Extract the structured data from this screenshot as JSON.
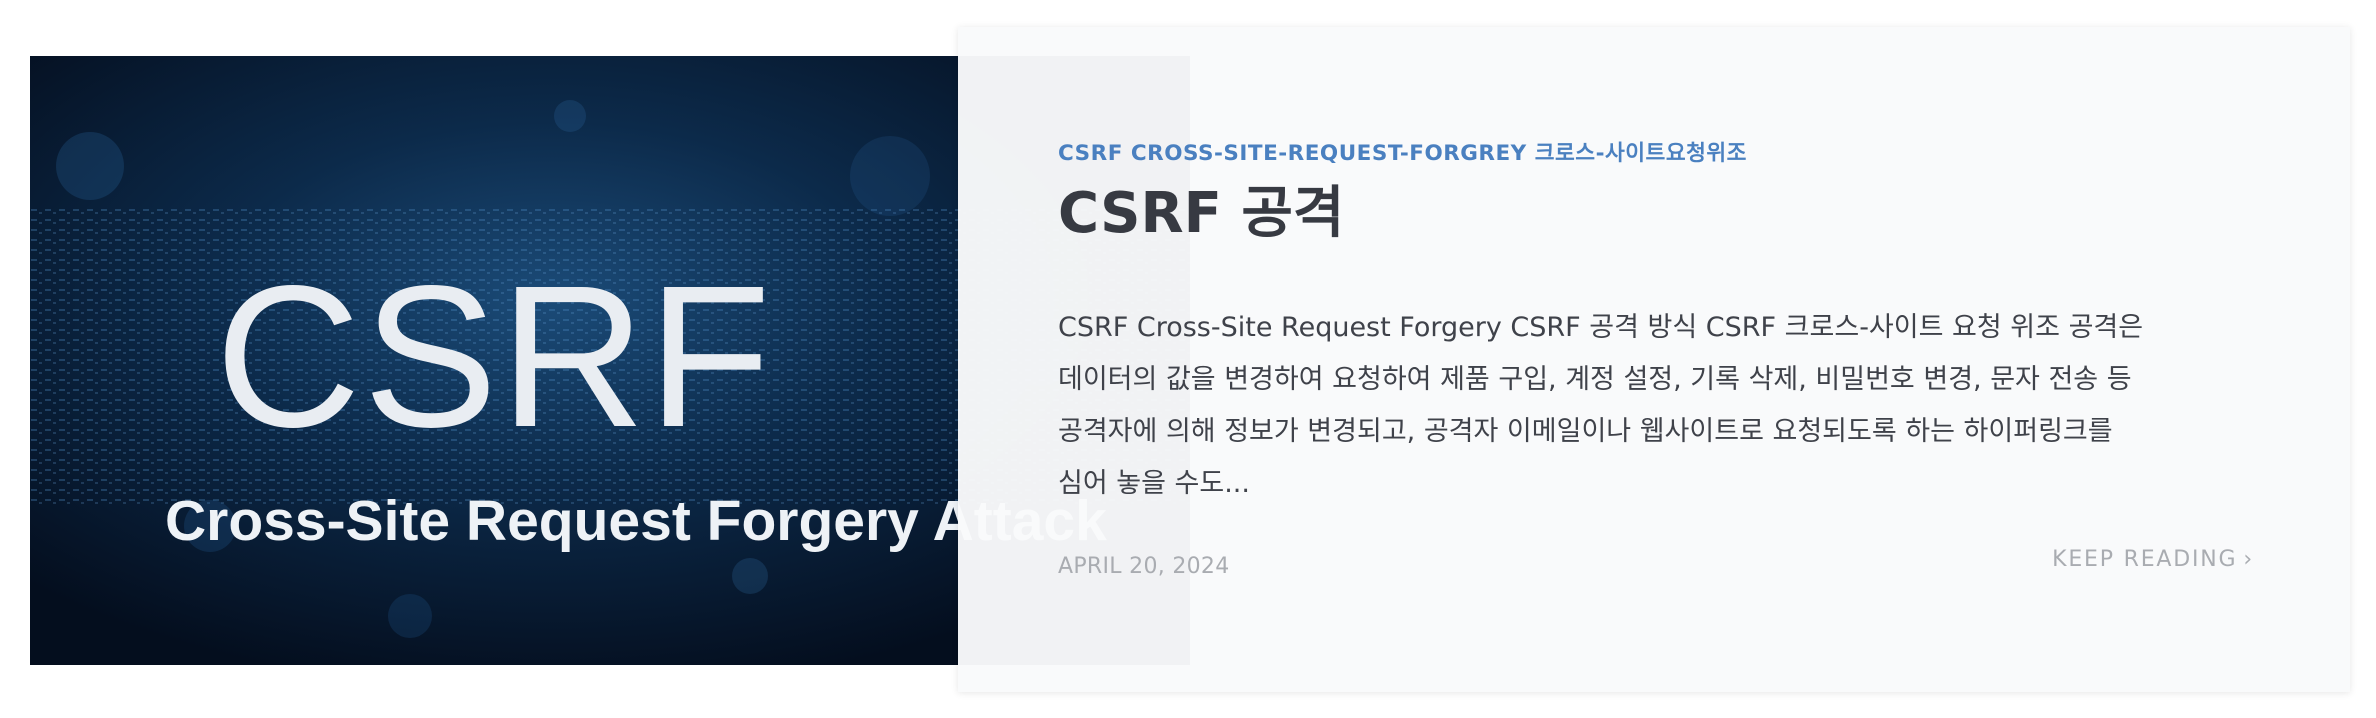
{
  "hero": {
    "title": "CSRF",
    "subtitle": "Cross-Site Request Forgery Attack"
  },
  "post": {
    "category": "CSRF CROSS-SITE-REQUEST-FORGREY 크로스-사이트요청위조",
    "title": "CSRF 공격",
    "excerpt_lines": [
      "CSRF Cross-Site Request Forgery CSRF 공격 방식 CSRF 크로스-사이트 요청 위조 공격은",
      "데이터의 값을 변경하여 요청하여 제품 구입, 계정 설정, 기록 삭제, 비밀번호 변경, 문자 전송 등",
      "공격자에 의해 정보가 변경되고, 공격자 이메일이나 웹사이트로 요청되도록 하는 하이퍼링크를",
      "심어 놓을 수도..."
    ],
    "date": "APRIL 20, 2024",
    "read_more": "KEEP READING",
    "read_more_icon": "chevron-right-icon"
  },
  "colors": {
    "category": "#4a80c0",
    "title": "#373a42",
    "meta": "#a9acb1",
    "hero_background": "#06162b"
  }
}
